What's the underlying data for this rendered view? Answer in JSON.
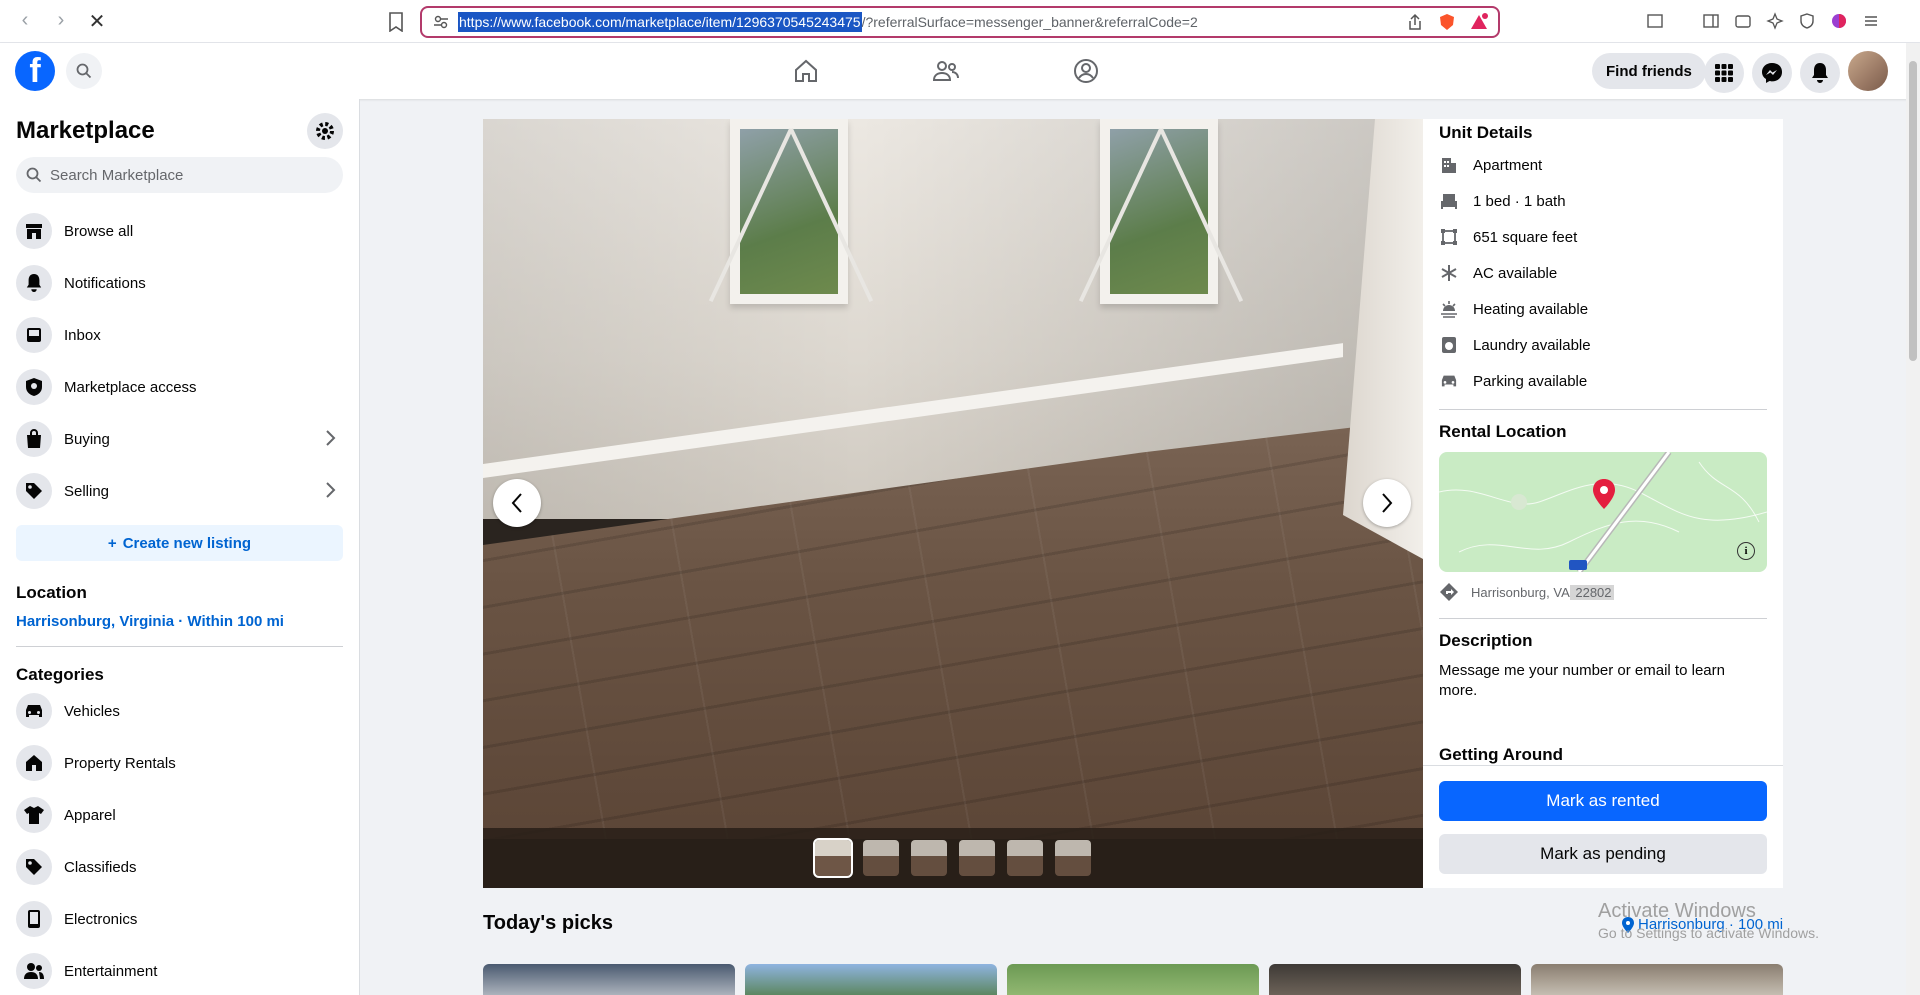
{
  "browser": {
    "url_selected": "https://www.facebook.com/marketplace/item/1296370545243475",
    "url_rest": "/?referralSurface=messenger_banner&referralCode=2"
  },
  "header": {
    "find_friends": "Find friends"
  },
  "sidebar": {
    "title": "Marketplace",
    "search_placeholder": "Search Marketplace",
    "menu": [
      {
        "label": "Browse all",
        "icon": "storefront-icon"
      },
      {
        "label": "Notifications",
        "icon": "bell-icon"
      },
      {
        "label": "Inbox",
        "icon": "inbox-icon"
      },
      {
        "label": "Marketplace access",
        "icon": "shield-icon"
      },
      {
        "label": "Buying",
        "icon": "shopping-bag-icon"
      },
      {
        "label": "Selling",
        "icon": "tag-icon"
      }
    ],
    "create_listing": "Create new listing",
    "location_heading": "Location",
    "location_value": "Harrisonburg, Virginia · Within 100 mi",
    "categories_heading": "Categories",
    "categories": [
      {
        "label": "Vehicles",
        "icon": "car-icon"
      },
      {
        "label": "Property Rentals",
        "icon": "house-icon"
      },
      {
        "label": "Apparel",
        "icon": "shirt-icon"
      },
      {
        "label": "Classifieds",
        "icon": "tag-icon"
      },
      {
        "label": "Electronics",
        "icon": "phone-icon"
      },
      {
        "label": "Entertainment",
        "icon": "people-icon"
      }
    ]
  },
  "details": {
    "unit_heading": "Unit Details",
    "attributes": [
      {
        "label": "Apartment",
        "icon": "building-icon"
      },
      {
        "label": "1 bed · 1 bath",
        "icon": "bed-icon"
      },
      {
        "label": "651 square feet",
        "icon": "area-icon"
      },
      {
        "label": "AC available",
        "icon": "snowflake-icon"
      },
      {
        "label": "Heating available",
        "icon": "heat-icon"
      },
      {
        "label": "Laundry available",
        "icon": "washer-icon"
      },
      {
        "label": "Parking available",
        "icon": "car-icon"
      }
    ],
    "rental_location_heading": "Rental Location",
    "location_city": "Harrisonburg, VA",
    "location_zip": " 22802",
    "description_heading": "Description",
    "description": " Message me your number or email to learn more.",
    "getting_around_heading": "Getting Around",
    "mark_rented": "Mark as rented",
    "mark_pending": "Mark as pending"
  },
  "picks": {
    "title": "Today's picks",
    "location": "Harrisonburg · 100 mi"
  },
  "watermark": {
    "line1": "Activate Windows",
    "line2": "Go to Settings to activate Windows."
  },
  "colors": {
    "fb_blue": "#0866ff",
    "link_blue": "#0064d1"
  }
}
